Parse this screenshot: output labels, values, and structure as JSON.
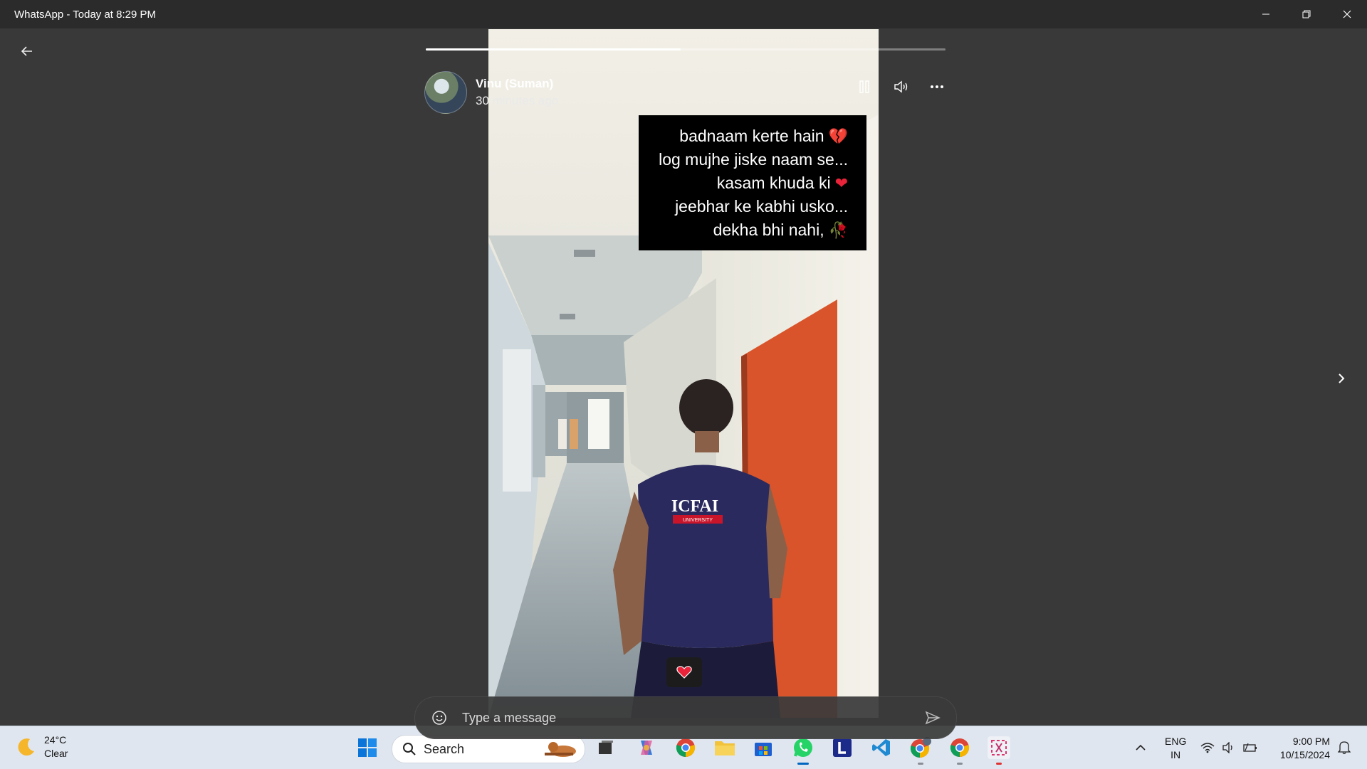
{
  "window": {
    "title": "WhatsApp - Today at 8:29 PM"
  },
  "story": {
    "progress_percent": 49,
    "contact_name": "Vinu (Suman)",
    "posted_time": "30 minutes ago",
    "caption_lines": [
      "badnaam kerte hain",
      "log mujhe jiske naam se...",
      "kasam khuda ki",
      "jeebhar ke kabhi usko...",
      "dekha bhi nahi,"
    ],
    "caption_emojis": [
      "💔",
      "",
      "❤",
      "",
      "🥀"
    ],
    "shirt_text": "ICFAI",
    "shirt_subtext": "UNIVERSITY"
  },
  "reply": {
    "placeholder": "Type a message"
  },
  "taskbar": {
    "weather_temp": "24°C",
    "weather_desc": "Clear",
    "search_label": "Search",
    "language_line1": "ENG",
    "language_line2": "IN",
    "time": "9:00 PM",
    "date": "10/15/2024"
  },
  "colors": {
    "background": "#393939",
    "titlebar": "#2b2b2b",
    "accent": "#0067c0",
    "door": "#d9542a"
  }
}
